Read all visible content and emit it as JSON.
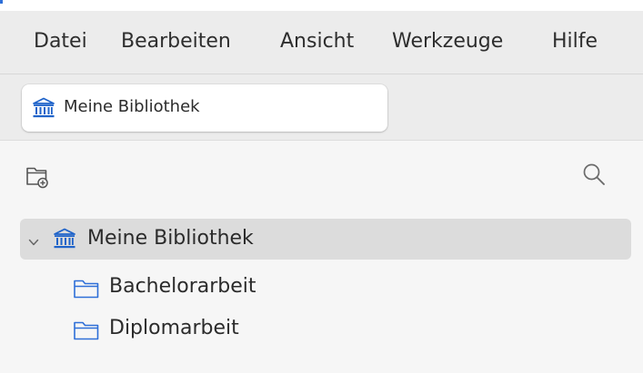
{
  "menubar": {
    "items": [
      "Datei",
      "Bearbeiten",
      "Ansicht",
      "Werkzeuge",
      "Hilfe"
    ]
  },
  "tab": {
    "label": "Meine Bibliothek",
    "icon": "library-icon"
  },
  "collections_pane": {
    "new_collection_icon": "new-collection-icon",
    "search_icon": "search-icon",
    "tree": {
      "root": {
        "label": "Meine Bibliothek",
        "icon": "library-icon",
        "expanded": true,
        "selected": true
      },
      "children": [
        {
          "label": "Bachelorarbeit",
          "icon": "folder-icon"
        },
        {
          "label": "Diplomarbeit",
          "icon": "folder-icon"
        }
      ]
    }
  },
  "colors": {
    "menubar_bg": "#ececec",
    "selection_bg": "#dcdcdc",
    "icon_blue": "#2e6fd8",
    "library_icon_blue": "#1f63c9"
  }
}
